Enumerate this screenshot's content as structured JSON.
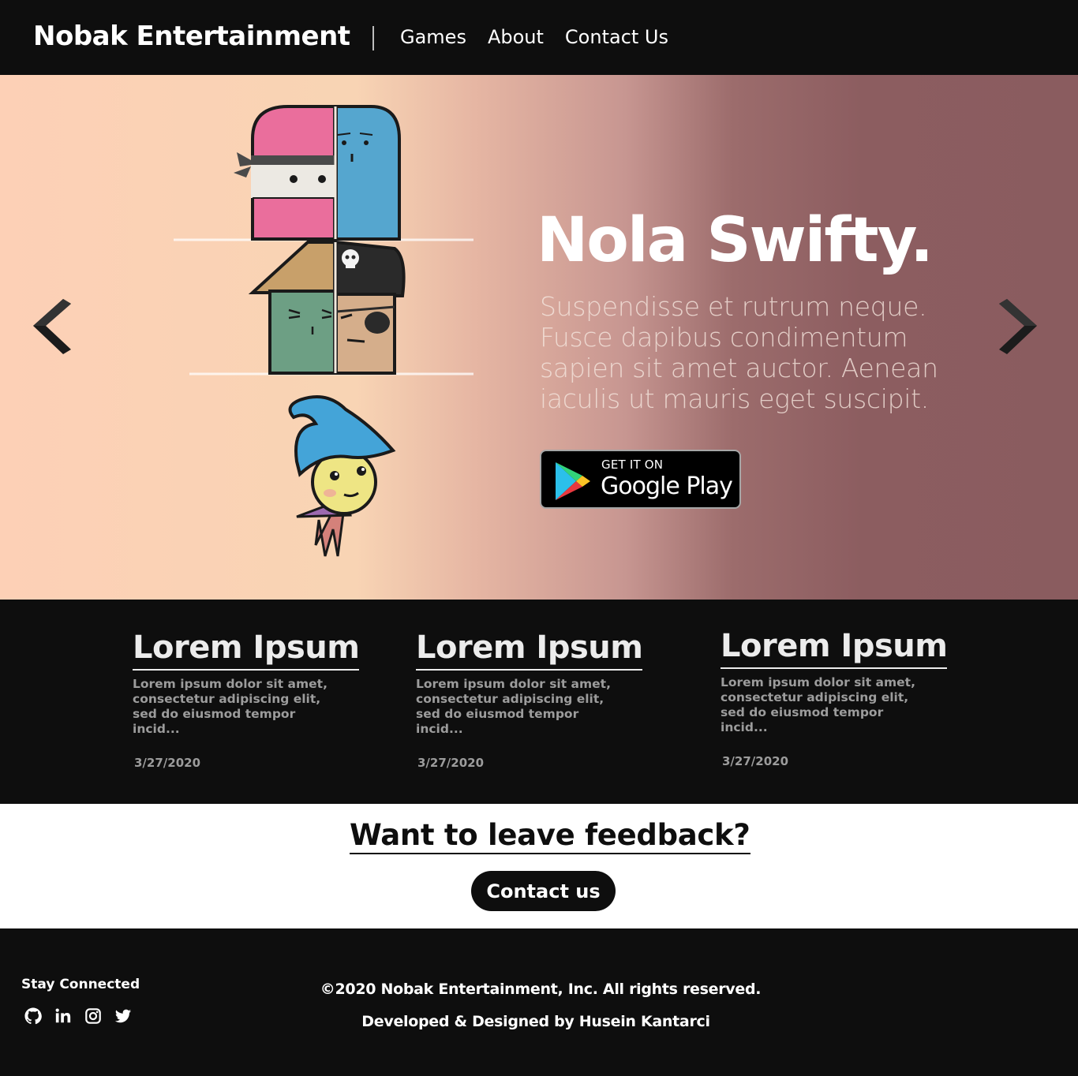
{
  "header": {
    "brand": "Nobak Entertainment",
    "nav": [
      "Games",
      "About",
      "Contact Us"
    ]
  },
  "hero": {
    "title": "Nola Swifty.",
    "description": "Suspendisse et rutrum neque. Fusce dapibus condimentum sapien sit amet auctor. Aenean iaculis ut mauris eget suscipit.",
    "badge_top": "GET IT ON",
    "badge_bottom": "Google Play",
    "colors": {
      "gradient_start": "#fdd0b6",
      "gradient_end": "#8a5c5f"
    }
  },
  "news": {
    "cards": [
      {
        "title": "Lorem Ipsum",
        "text": "Lorem ipsum dolor sit amet, consectetur adipiscing elit, sed do eiusmod tempor incid...",
        "date": "3/27/2020"
      },
      {
        "title": "Lorem Ipsum",
        "text": "Lorem ipsum dolor sit amet, consectetur adipiscing elit, sed do eiusmod tempor incid...",
        "date": "3/27/2020"
      },
      {
        "title": "Lorem Ipsum",
        "text": "Lorem ipsum dolor sit amet, consectetur adipiscing elit, sed do eiusmod tempor incid...",
        "date": "3/27/2020"
      }
    ]
  },
  "feedback": {
    "title": "Want to leave feedback?",
    "button": "Contact us"
  },
  "footer": {
    "stay_connected": "Stay Connected",
    "socials": [
      "github-icon",
      "linkedin-icon",
      "instagram-icon",
      "twitter-icon"
    ],
    "copyright": "©2020 Nobak Entertainment, Inc. All rights reserved.",
    "developer": "Developed & Designed by Husein Kantarci"
  }
}
